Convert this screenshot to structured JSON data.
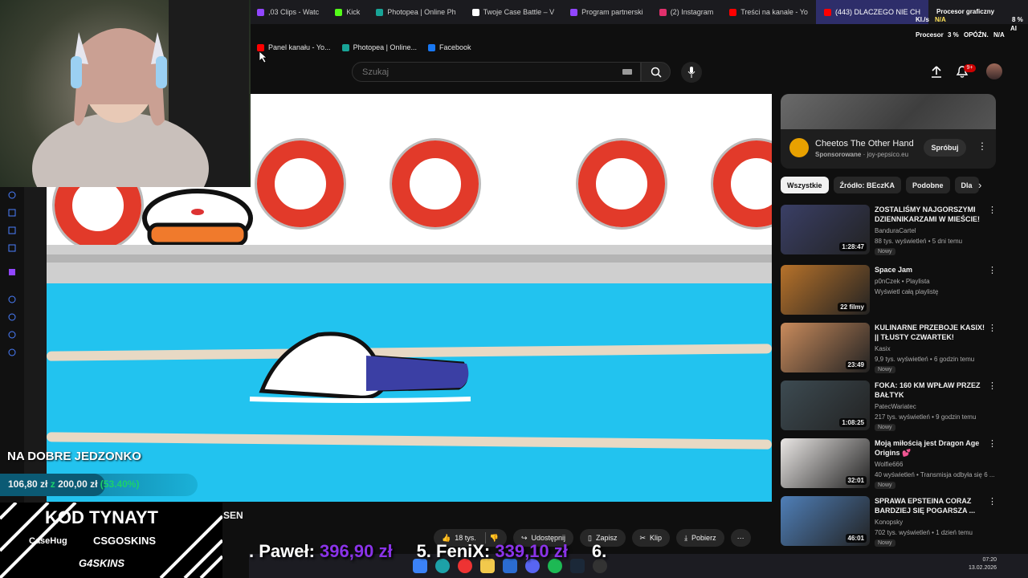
{
  "browser": {
    "tabs": [
      {
        "label": ",03 Clips - Watc",
        "color": "#9146ff"
      },
      {
        "label": "Kick",
        "color": "#53fc18"
      },
      {
        "label": "Photopea | Online Ph",
        "color": "#18a497"
      },
      {
        "label": "Twoje Case Battle – V",
        "color": "#ffffff"
      },
      {
        "label": "Program partnerski",
        "color": "#9146ff"
      },
      {
        "label": "(2) Instagram",
        "color": "#e1306c"
      },
      {
        "label": "Treści na kanale - Yo",
        "color": "#ff0000"
      },
      {
        "label": "(443) DLACZEGO NIE CH",
        "color": "#ff0000"
      }
    ],
    "bookmarks": [
      {
        "label": "Panel kanału - Yo...",
        "color": "#ff0000"
      },
      {
        "label": "Photopea | Online...",
        "color": "#18a497"
      },
      {
        "label": "Facebook",
        "color": "#1877f2"
      }
    ]
  },
  "perf_overlay": {
    "procesor_graficzny": "Procesor graficzny",
    "gpu_value": "8 %",
    "kb_label": "Kl./s",
    "kb_value": "N/A",
    "procesor_label": "Procesor",
    "procesor_value": "3 %",
    "opozn_label": "OPÓŹN.",
    "opozn_value": "N/A",
    "ai_label": "AI"
  },
  "youtube": {
    "search_placeholder": "Szukaj",
    "notifications_badge": "9+",
    "ad": {
      "title": "Cheetos The Other Hand",
      "sponsored": "Sponsorowane",
      "domain": "joy-pepsico.eu",
      "button": "Spróbuj"
    },
    "chips": [
      "Wszystkie",
      "Źródło: BEczKA",
      "Podobne",
      "Dla"
    ],
    "recommendations": [
      {
        "title": "ZOSTALIŚMY NAJGORSZYMI DZIENNIKARZAMI W MIEŚCIE!",
        "channel": "BanduraCartel",
        "meta": "88 tys. wyświetleń • 5 dni temu",
        "badge": "Nowy",
        "duration": "1:28:47",
        "thumb_color": "#3a3f66"
      },
      {
        "title": "Space Jam",
        "channel": "p0nCzek • Playlista",
        "meta": "Wyświetl całą playlistę",
        "badge": "",
        "duration": "22 filmy",
        "thumb_color": "#b7722a"
      },
      {
        "title": "KULINARNE PRZEBOJE KASIX! || TŁUSTY CZWARTEK!",
        "channel": "Kasix",
        "meta": "9,9 tys. wyświetleń • 6 godzin temu",
        "badge": "Nowy",
        "duration": "23:49",
        "thumb_color": "#c98b5c"
      },
      {
        "title": "FOKA: 160 KM WPŁAW PRZEZ BAŁTYK",
        "channel": "PatecWariatec",
        "meta": "217 tys. wyświetleń • 9 godzin temu",
        "badge": "Nowy",
        "duration": "1:08:25",
        "thumb_color": "#3d4b52"
      },
      {
        "title": "Moją miłością jest Dragon Age Origins 💕",
        "channel": "Wolfie666",
        "meta": "40 wyświetleń • Transmisja odbyła się 6 ...",
        "badge": "Nowy",
        "duration": "32:01",
        "thumb_color": "#e9e6e4"
      },
      {
        "title": "SPRAWA EPSTEINA CORAZ BARDZIEJ SIĘ POGARSZA ...",
        "channel": "Konopsky",
        "meta": "702 tys. wyświetleń • 1 dzień temu",
        "badge": "Nowy",
        "duration": "46:01",
        "thumb_color": "#4f7fb8"
      }
    ],
    "actions": {
      "likes": "18 tys.",
      "share": "Udostępnij",
      "save": "Zapisz",
      "clip": "Klip",
      "download": "Pobierz"
    },
    "channel_fragment": "SEN"
  },
  "stream_overlay": {
    "goal_title": "NA DOBRE JEDZONKO",
    "goal_current": "106,80 zł",
    "goal_sep": "z",
    "goal_target": "200,00 zł",
    "goal_percent": "(53.40%)",
    "goal_progress": 0.534,
    "code_title": "KOD TYNAYT",
    "sponsors": [
      "CaseHug",
      "CSGOSKINS",
      "G4SKINS"
    ],
    "donors": [
      {
        "name": ". Paweł:",
        "amount": "396,90 zł"
      },
      {
        "name": "5. FeniX:",
        "amount": "339,10 zł"
      },
      {
        "name": "6.",
        "amount": ""
      }
    ]
  },
  "taskbar": {
    "time": "07:20",
    "date": "13.02.2026"
  }
}
